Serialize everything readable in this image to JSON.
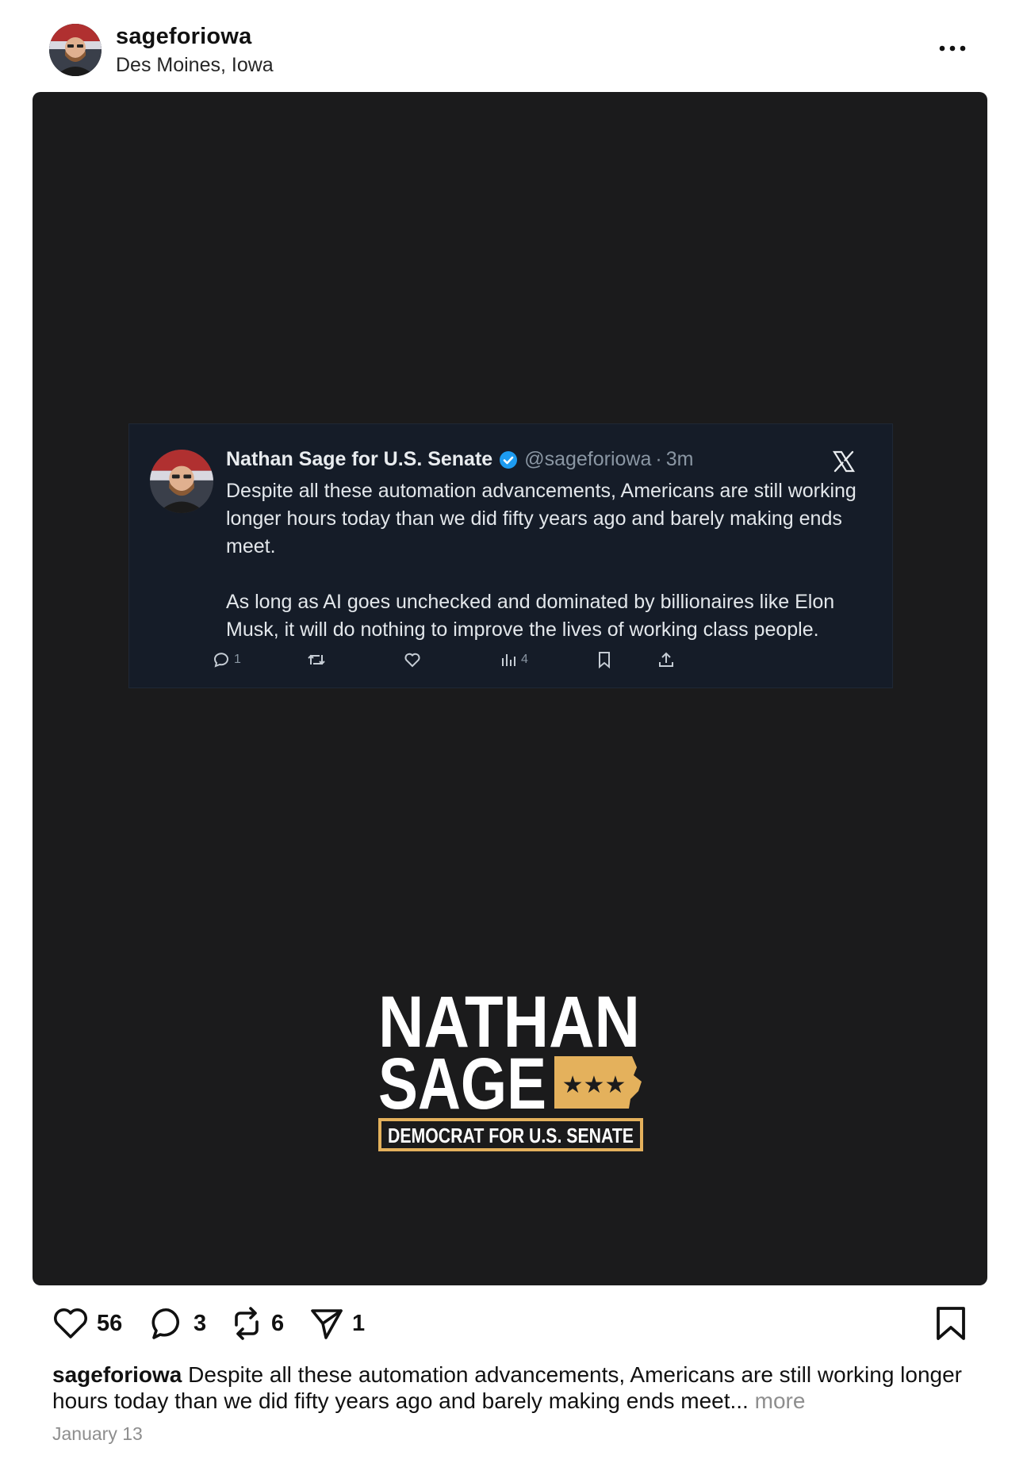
{
  "header": {
    "username": "sageforiowa",
    "location": "Des Moines, Iowa"
  },
  "tweet": {
    "name": "Nathan Sage for U.S. Senate",
    "handle": "@sageforiowa",
    "separator": "·",
    "time": "3m",
    "paragraph1": "Despite all these automation advancements, Americans are still working longer hours today than we did fifty years ago and barely making ends meet.",
    "paragraph2": "As long as AI goes unchecked and dominated by billionaires like Elon Musk, it will do nothing to improve the lives of working class people.",
    "reply_count": "1",
    "views_count": "4"
  },
  "logo": {
    "line1": "NATHAN",
    "line2": "SAGE",
    "line3": "DEMOCRAT FOR U.S. SENATE",
    "brand_color": "#e4b15c"
  },
  "actions": {
    "likes": "56",
    "comments": "3",
    "reposts": "6",
    "shares": "1"
  },
  "caption": {
    "username": "sageforiowa",
    "text": "Despite all these automation advancements, Americans are still working longer hours today than we did fifty years ago and barely making ends meet...",
    "more": "more"
  },
  "date": "January 13",
  "colors": {
    "media_bg": "#1b1b1c",
    "tweet_bg": "#151c28",
    "verified": "#1d9bf0"
  }
}
